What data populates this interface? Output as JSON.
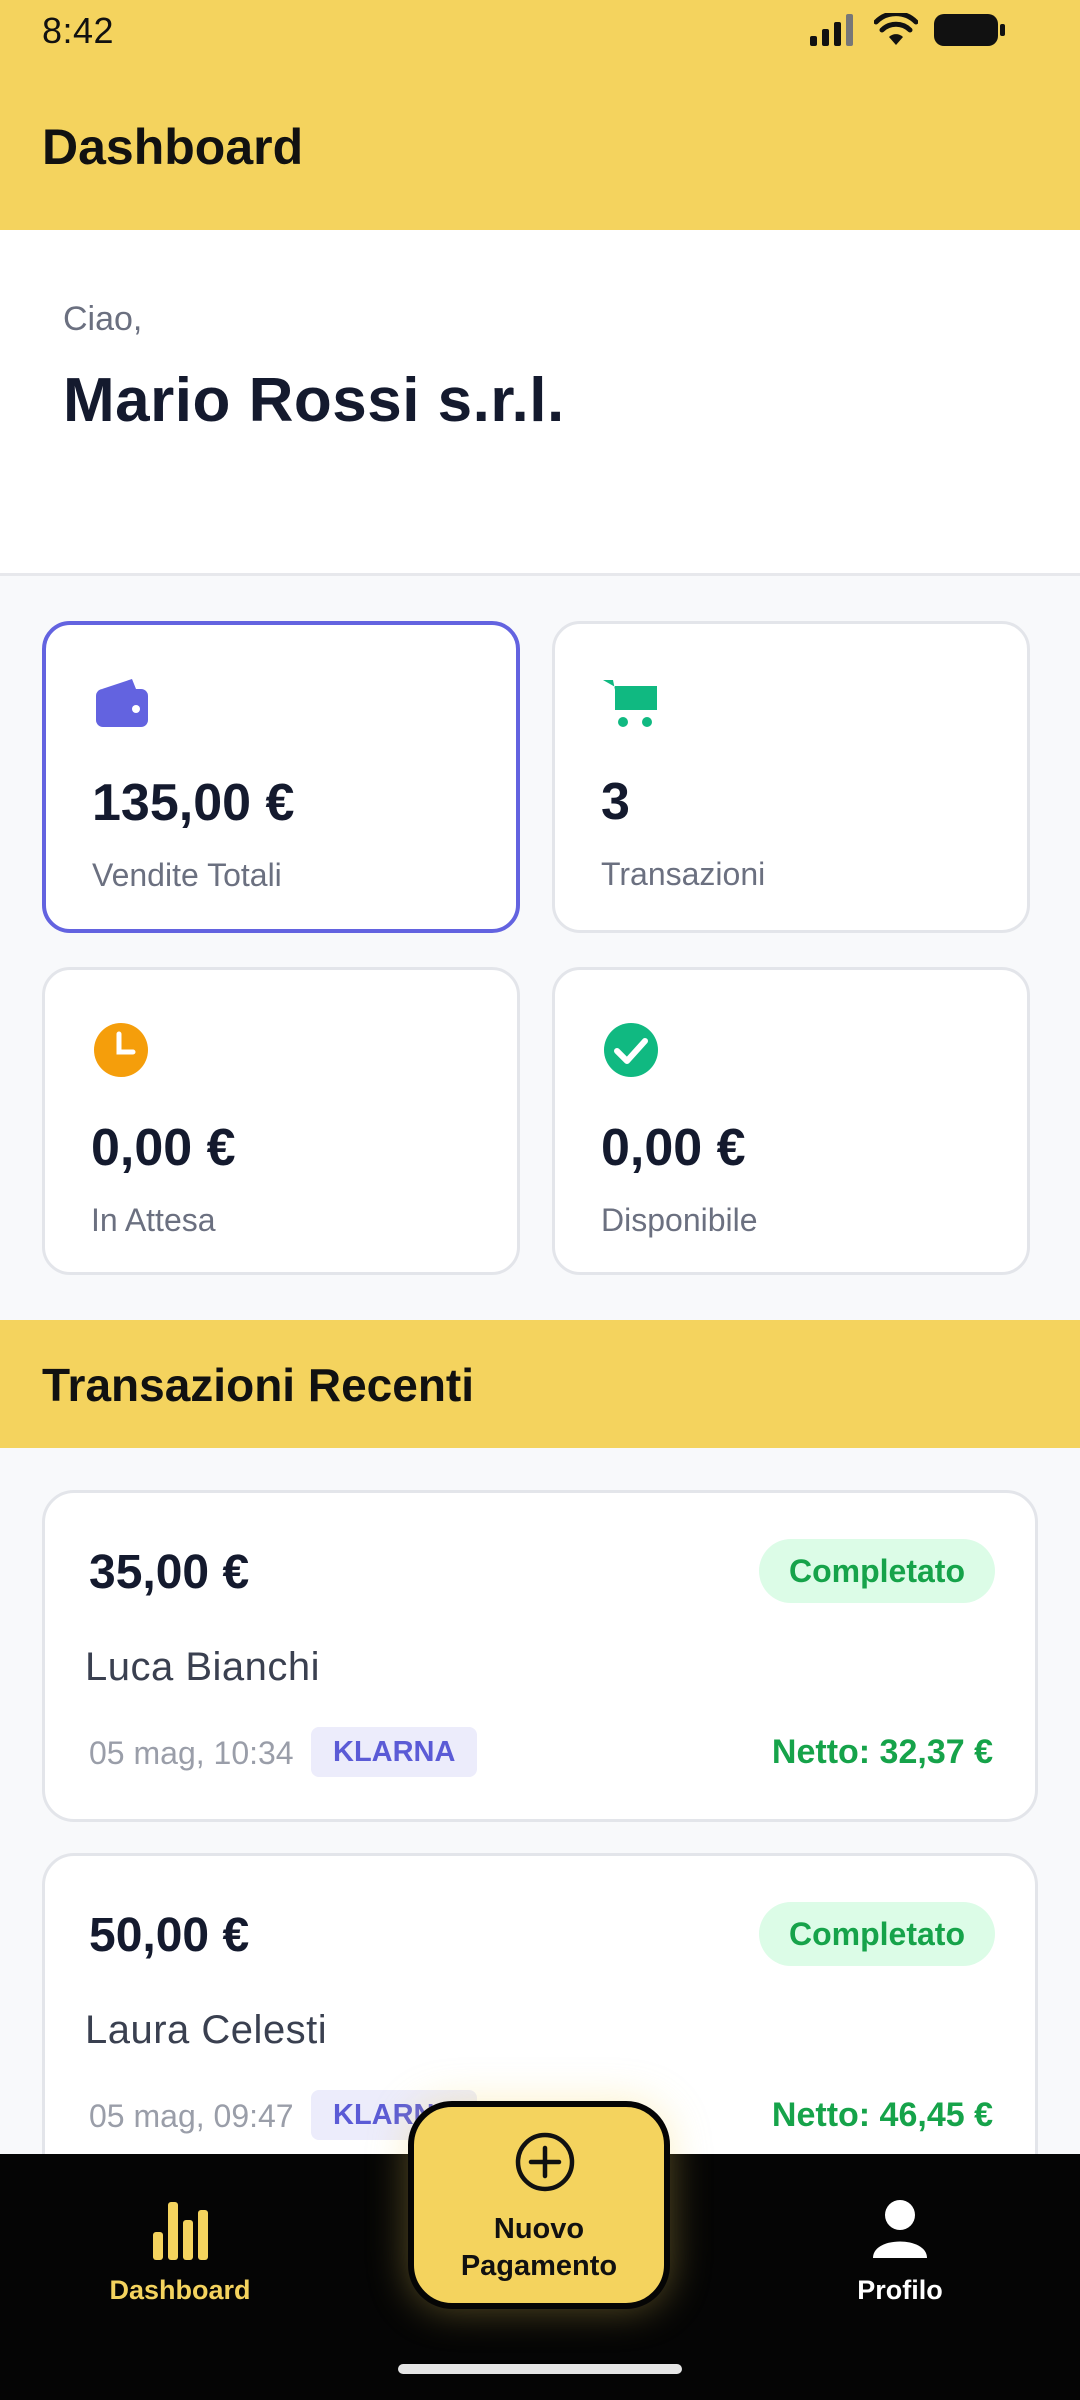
{
  "status_bar": {
    "time": "8:42"
  },
  "header": {
    "title": "Dashboard"
  },
  "greeting": {
    "hello": "Ciao,",
    "name": "Mario Rossi s.r.l."
  },
  "stats": [
    {
      "icon": "wallet-icon",
      "value": "135,00 €",
      "label": "Vendite Totali",
      "color": "#6363e0",
      "active": true
    },
    {
      "icon": "cart-icon",
      "value": "3",
      "label": "Transazioni",
      "color": "#10b981",
      "active": false
    },
    {
      "icon": "clock-icon",
      "value": "0,00 €",
      "label": "In Attesa",
      "color": "#f59e0b",
      "active": false
    },
    {
      "icon": "check-circle-icon",
      "value": "0,00 €",
      "label": "Disponibile",
      "color": "#10b981",
      "active": false
    }
  ],
  "recent": {
    "title": "Transazioni Recenti",
    "transactions": [
      {
        "amount": "35,00 €",
        "status": "Completato",
        "customer": "Luca Bianchi",
        "date": "05 mag, 10:34",
        "method": "KLARNA",
        "net": "Netto: 32,37 €"
      },
      {
        "amount": "50,00 €",
        "status": "Completato",
        "customer": "Laura Celesti",
        "date": "05 mag, 09:47",
        "method": "KLARNA",
        "net": "Netto: 46,45 €"
      }
    ]
  },
  "bottom_nav": {
    "dashboard_label": "Dashboard",
    "new_payment_label_line1": "Nuovo",
    "new_payment_label_line2": "Pagamento",
    "profile_label": "Profilo"
  },
  "colors": {
    "brand_yellow": "#f4d35e",
    "accent_purple": "#6363e0",
    "success_green": "#16a34a"
  }
}
